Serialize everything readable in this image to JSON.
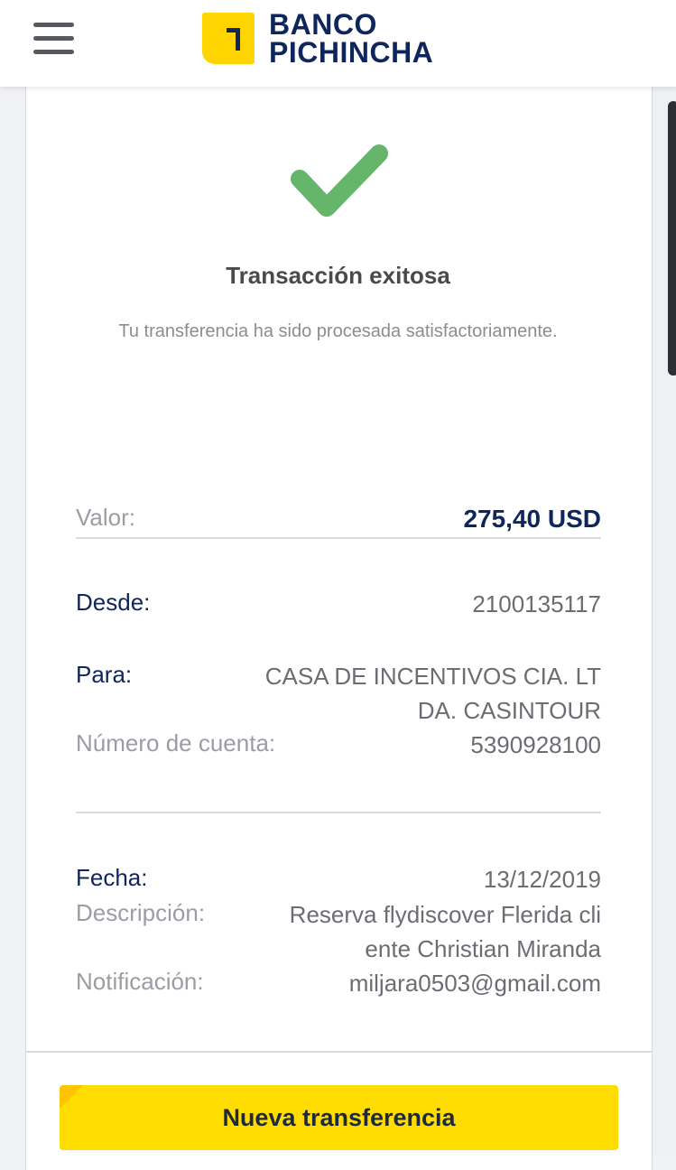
{
  "header": {
    "logo_line1": "BANCO",
    "logo_line2": "PICHINCHA",
    "icons": {
      "menu": "hamburger-menu-icon",
      "logo": "banco-pichincha-logo-icon"
    }
  },
  "status": {
    "icon": "checkmark-icon",
    "title": "Transacción exitosa",
    "subtitle": "Tu transferencia ha sido procesada satisfactoriamente."
  },
  "details": {
    "valor_label": "Valor:",
    "valor": "275,40 USD",
    "desde_label": "Desde:",
    "desde": "2100135117",
    "para_label": "Para:",
    "para_line1": "CASA DE INCENTIVOS CIA. LT",
    "para_line2": "DA. CASINTOUR",
    "cuenta_label": "Número de cuenta:",
    "cuenta": "5390928100",
    "fecha_label": "Fecha:",
    "fecha": "13/12/2019",
    "descripcion_label": "Descripción:",
    "descripcion_line1": "Reserva flydiscover Flerida cli",
    "descripcion_line2": "ente Christian Miranda",
    "notificacion_label": "Notificación:",
    "notificacion": "miljara0503@gmail.com"
  },
  "actions": {
    "new_transfer": "Nueva transferencia"
  },
  "colors": {
    "brand_yellow": "#ffdd00",
    "brand_navy": "#0f265c",
    "success_green": "#65b56b",
    "muted_gray": "#9a9da3"
  }
}
